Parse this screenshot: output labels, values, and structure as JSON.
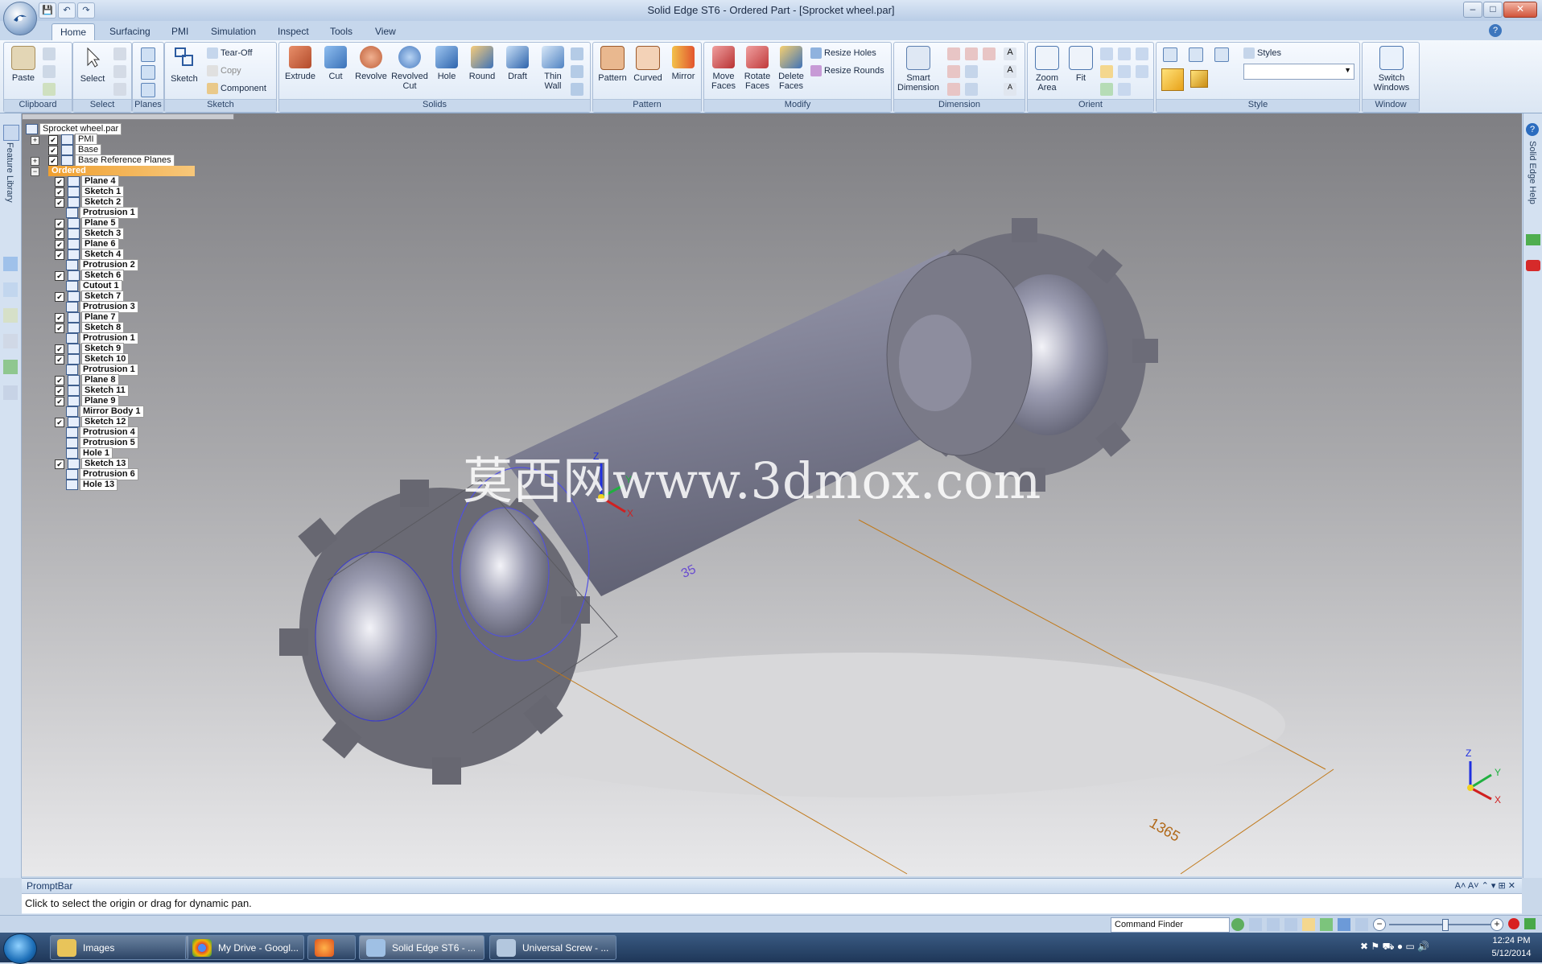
{
  "window": {
    "title": "Solid Edge ST6 - Ordered Part - [Sprocket wheel.par]"
  },
  "tabs": [
    "Home",
    "Surfacing",
    "PMI",
    "Simulation",
    "Inspect",
    "Tools",
    "View"
  ],
  "ribbon": {
    "clipboard": {
      "label": "Clipboard",
      "paste": "Paste"
    },
    "select": {
      "label": "Select",
      "select": "Select"
    },
    "planes": {
      "label": "Planes"
    },
    "sketch": {
      "label": "Sketch",
      "sketch": "Sketch",
      "tear_off": "Tear-Off",
      "copy": "Copy",
      "component": "Component"
    },
    "solids": {
      "label": "Solids",
      "extrude": "Extrude",
      "cut": "Cut",
      "revolve": "Revolve",
      "revolved_cut": "Revolved Cut",
      "hole": "Hole",
      "round": "Round",
      "draft": "Draft",
      "thin_wall": "Thin Wall"
    },
    "pattern": {
      "label": "Pattern",
      "pattern": "Pattern",
      "curved": "Curved",
      "mirror": "Mirror"
    },
    "modify": {
      "label": "Modify",
      "move_faces": "Move Faces",
      "rotate_faces": "Rotate Faces",
      "delete_faces": "Delete Faces",
      "resize_holes": "Resize Holes",
      "resize_rounds": "Resize Rounds"
    },
    "dimension": {
      "label": "Dimension",
      "smart_dimension": "Smart Dimension"
    },
    "orient": {
      "label": "Orient",
      "zoom_area": "Zoom Area",
      "fit": "Fit"
    },
    "style": {
      "label": "Style",
      "styles": "Styles"
    },
    "window": {
      "label": "Window",
      "switch_windows": "Switch Windows"
    }
  },
  "side": {
    "left_label": "Feature Library",
    "right_label": "Solid Edge Help"
  },
  "tree": {
    "root": "Sprocket wheel.par",
    "top": [
      "PMI",
      "Base",
      "Base Reference Planes",
      "Ordered"
    ],
    "features": [
      {
        "label": "Plane 4",
        "checked": true
      },
      {
        "label": "Sketch 1",
        "checked": true
      },
      {
        "label": "Sketch 2",
        "checked": true
      },
      {
        "label": "Protrusion 1",
        "checked": false
      },
      {
        "label": "Plane 5",
        "checked": true
      },
      {
        "label": "Sketch 3",
        "checked": true
      },
      {
        "label": "Plane 6",
        "checked": true
      },
      {
        "label": "Sketch 4",
        "checked": true
      },
      {
        "label": "Protrusion 2",
        "checked": false
      },
      {
        "label": "Sketch 6",
        "checked": true
      },
      {
        "label": "Cutout 1",
        "checked": false
      },
      {
        "label": "Sketch 7",
        "checked": true
      },
      {
        "label": "Protrusion 3",
        "checked": false
      },
      {
        "label": "Plane 7",
        "checked": true
      },
      {
        "label": "Sketch 8",
        "checked": true
      },
      {
        "label": "Protrusion 1",
        "checked": false
      },
      {
        "label": "Sketch 9",
        "checked": true
      },
      {
        "label": "Sketch 10",
        "checked": true
      },
      {
        "label": "Protrusion 1",
        "checked": false
      },
      {
        "label": "Plane 8",
        "checked": true
      },
      {
        "label": "Sketch 11",
        "checked": true
      },
      {
        "label": "Plane 9",
        "checked": true
      },
      {
        "label": "Mirror Body 1",
        "checked": false
      },
      {
        "label": "Sketch 12",
        "checked": true
      },
      {
        "label": "Protrusion 4",
        "checked": false
      },
      {
        "label": "Protrusion 5",
        "checked": false
      },
      {
        "label": "Hole 1",
        "checked": false
      },
      {
        "label": "Sketch 13",
        "checked": true
      },
      {
        "label": "Protrusion 6",
        "checked": false
      },
      {
        "label": "Hole 13",
        "checked": false
      }
    ]
  },
  "viewport": {
    "watermark": "莫西网www.3dmox.com",
    "dim_left": "35",
    "dim_right": "1365",
    "axis": {
      "z": "Z",
      "y": "Y",
      "x": "X"
    }
  },
  "promptbar": {
    "title": "PromptBar",
    "message": "Click to select the origin or drag for dynamic pan."
  },
  "statusbar": {
    "command_finder": "Command Finder"
  },
  "taskbar": {
    "items": [
      "Images",
      "My Drive - Googl...",
      "",
      "Solid Edge ST6 - ...",
      "Universal Screw - ..."
    ],
    "time": "12:24 PM",
    "date": "5/12/2014"
  },
  "colors": {
    "accent": "#f0a030",
    "ribbon": "#dbe6f3",
    "viewport_top": "#7f7f83",
    "viewport_bottom": "#e8e8ea",
    "dimension": "#c07818"
  }
}
